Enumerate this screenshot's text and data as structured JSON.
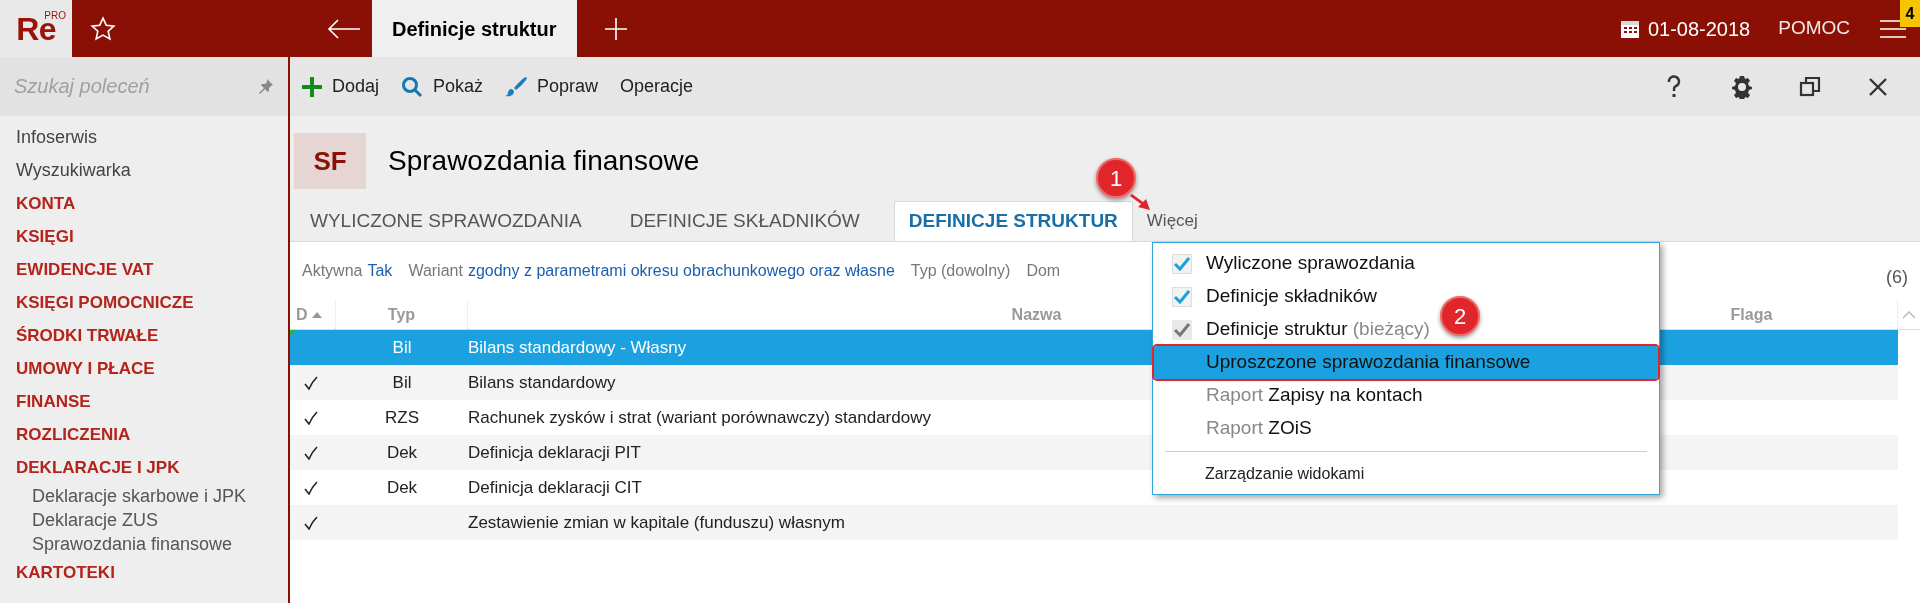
{
  "app": {
    "logo": "Re",
    "logo_sup": "PRO",
    "tabs": [
      {
        "label": "Definicje struktur",
        "selected": true
      }
    ],
    "date": "01-08-2018",
    "help": "POMOC",
    "notification_count": "4"
  },
  "sidebar": {
    "search": {
      "placeholder": "Szukaj poleceń"
    },
    "items": [
      {
        "label": "Infoserwis",
        "kind": "link"
      },
      {
        "label": "Wyszukiwarka",
        "kind": "link"
      },
      {
        "label": "KONTA",
        "kind": "section"
      },
      {
        "label": "KSIĘGI",
        "kind": "section"
      },
      {
        "label": "EWIDENCJE VAT",
        "kind": "section"
      },
      {
        "label": "KSIĘGI POMOCNICZE",
        "kind": "section"
      },
      {
        "label": "ŚRODKI TRWAŁE",
        "kind": "section"
      },
      {
        "label": "UMOWY I PŁACE",
        "kind": "section"
      },
      {
        "label": "FINANSE",
        "kind": "section"
      },
      {
        "label": "ROZLICZENIA",
        "kind": "section"
      },
      {
        "label": "DEKLARACJE I JPK",
        "kind": "section"
      },
      {
        "label": "Deklaracje skarbowe i JPK",
        "kind": "sub"
      },
      {
        "label": "Deklaracje ZUS",
        "kind": "sub"
      },
      {
        "label": "Sprawozdania finansowe",
        "kind": "sub"
      },
      {
        "label": "KARTOTEKI",
        "kind": "section"
      }
    ]
  },
  "toolbar": {
    "buttons": [
      {
        "label": "Dodaj",
        "kind": "add"
      },
      {
        "label": "Pokaż",
        "kind": "search"
      },
      {
        "label": "Popraw",
        "kind": "edit"
      },
      {
        "label": "Operacje",
        "kind": "plain"
      }
    ]
  },
  "module": {
    "badge": "SF",
    "title": "Sprawozdania finansowe"
  },
  "view_tabs": [
    {
      "label": "WYLICZONE SPRAWOZDANIA",
      "selected": false
    },
    {
      "label": "DEFINICJE SKŁADNIKÓW",
      "selected": false
    },
    {
      "label": "DEFINICJE STRUKTUR",
      "selected": true
    }
  ],
  "more": "Więcej",
  "filters": [
    {
      "label": "Aktywna",
      "value": "Tak"
    },
    {
      "label": "Wariant",
      "value": "zgodny z parametrami okresu obrachunkowego oraz własne"
    },
    {
      "label": "Typ (dowolny)"
    },
    {
      "label": "Dom"
    }
  ],
  "count": "(6)",
  "table": {
    "columns": [
      "D",
      "Typ",
      "Nazwa",
      "Flaga"
    ],
    "rows": [
      {
        "checked": false,
        "type": "Bil",
        "name": "Bilans standardowy - Własny",
        "selected": true
      },
      {
        "checked": true,
        "type": "Bil",
        "name": "Bilans standardowy",
        "selected": false
      },
      {
        "checked": true,
        "type": "RZS",
        "name": "Rachunek zysków i strat (wariant porównawczy) standardowy",
        "selected": false
      },
      {
        "checked": true,
        "type": "Dek",
        "name": "Definicja deklaracji PIT",
        "selected": false
      },
      {
        "checked": true,
        "type": "Dek",
        "name": "Definicja deklaracji CIT",
        "selected": false
      },
      {
        "checked": true,
        "name": "Zestawienie zmian w kapitale (funduszu) własnym",
        "selected": false
      }
    ]
  },
  "menu": {
    "items": [
      {
        "kind": "view",
        "label": "Wyliczone sprawozdania",
        "checked": true,
        "selected": false
      },
      {
        "kind": "view",
        "label": "Definicje składników",
        "checked": true,
        "selected": false
      },
      {
        "kind": "view",
        "label": "Definicje struktur",
        "note": "(bieżący)",
        "checked": true,
        "current": true,
        "selected": false
      },
      {
        "kind": "view",
        "label": "Uproszczone sprawozdania finansowe",
        "checked": false,
        "selected": true
      },
      {
        "kind": "view",
        "prefix": "Raport",
        "label": "Zapisy na kontach",
        "checked": false,
        "selected": false
      },
      {
        "kind": "view",
        "prefix": "Raport",
        "label": "ZOiS",
        "checked": false,
        "selected": false
      },
      {
        "kind": "action",
        "label": "Zarządzanie widokami"
      }
    ]
  },
  "callouts": [
    {
      "label": "1"
    },
    {
      "label": "2"
    }
  ]
}
